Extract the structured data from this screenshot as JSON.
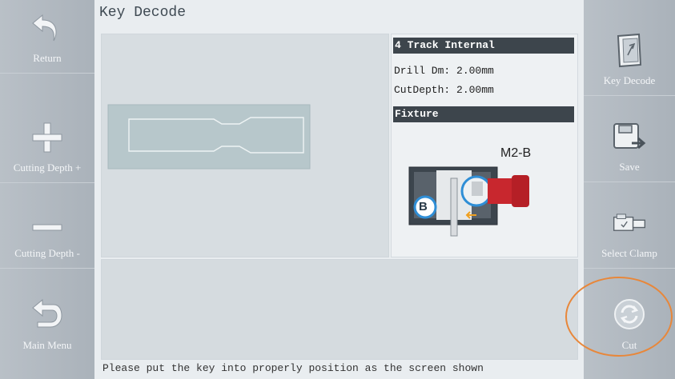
{
  "title": "Key Decode",
  "left_sidebar": [
    {
      "label": "Return",
      "icon": "return-arrow-icon"
    },
    {
      "label": "Cutting Depth +",
      "icon": "plus-icon"
    },
    {
      "label": "Cutting Depth -",
      "icon": "minus-icon"
    },
    {
      "label": "Main Menu",
      "icon": "main-menu-arrow-icon"
    }
  ],
  "right_sidebar": [
    {
      "label": "Key Decode",
      "icon": "key-decode-icon"
    },
    {
      "label": "Save",
      "icon": "save-icon"
    },
    {
      "label": "Select Clamp",
      "icon": "clamp-icon"
    },
    {
      "label": "Cut",
      "icon": "cut-icon"
    }
  ],
  "info": {
    "key_type": "4 Track Internal",
    "drill": "Drill Dm: 2.00mm",
    "cut_depth": "CutDepth: 2.00mm",
    "fixture_heading": "Fixture",
    "fixture_model": "M2-B",
    "fixture_marker": "B"
  },
  "status_message": "Please put the key into properly position as the screen shown",
  "colors": {
    "sidebar": "#aab2ba",
    "header_bar": "#3d454c",
    "highlight_ring": "#e8873a",
    "clamp_red": "#c8272e",
    "marker_blue": "#2f8ed6"
  }
}
